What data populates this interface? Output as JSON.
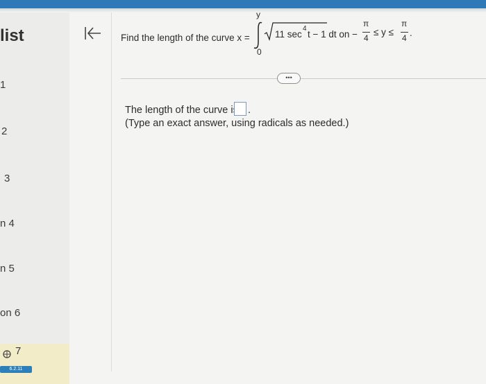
{
  "sidebar": {
    "title": "list",
    "items": [
      {
        "label": "1"
      },
      {
        "label": "2"
      },
      {
        "label": "3"
      },
      {
        "label": "n 4"
      },
      {
        "label": "n 5"
      },
      {
        "label": "on 6"
      },
      {
        "label": "7"
      }
    ],
    "badge": "6.2.11",
    "colors": {
      "active_bg": "#f2ecc9",
      "badge_bg": "#2c7fb9",
      "topbar": "#2f79b7"
    }
  },
  "question": {
    "prompt": "Find the length of the curve x =",
    "upper_limit": "y",
    "lower_limit": "0",
    "integrand_coef": "11 sec",
    "integrand_exp": "4",
    "integrand_rest": "t − 1 dt on  −",
    "pi": "π",
    "four": "4",
    "ineq": "≤ y ≤",
    "end": "."
  },
  "more_button": "•••",
  "answer": {
    "label": "The length of the curve is",
    "period": ".",
    "note": "(Type an exact answer, using radicals as needed.)"
  }
}
